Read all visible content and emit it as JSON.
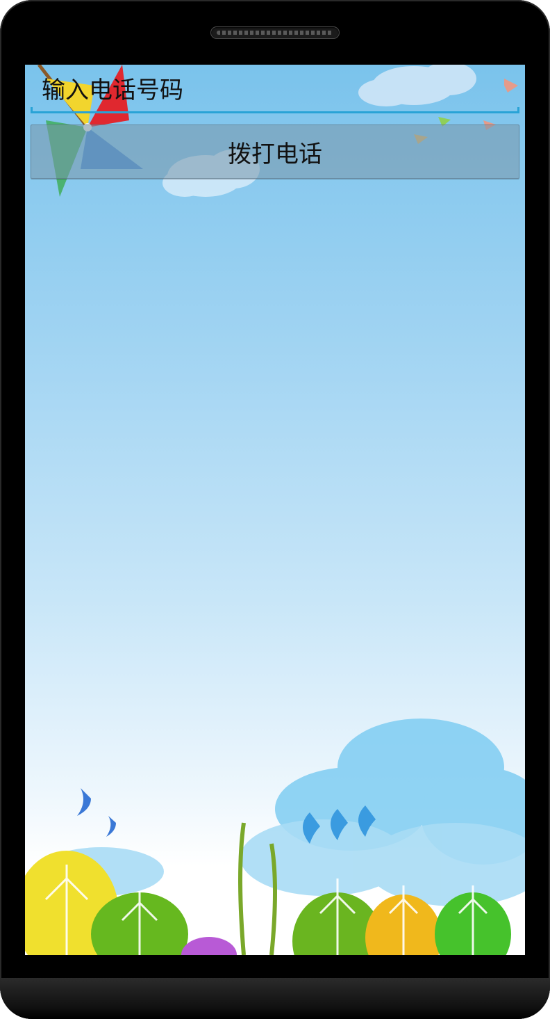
{
  "input": {
    "placeholder": "输入电话号码",
    "value": ""
  },
  "call_button": {
    "label": "拨打电话"
  },
  "colors": {
    "accent": "#29a3d6",
    "sky_top": "#7ac3ec",
    "device": "#000000"
  },
  "icons": [
    "pinwheel-icon",
    "bird-icon",
    "cloud-icon",
    "tree-icon",
    "grass-icon"
  ]
}
